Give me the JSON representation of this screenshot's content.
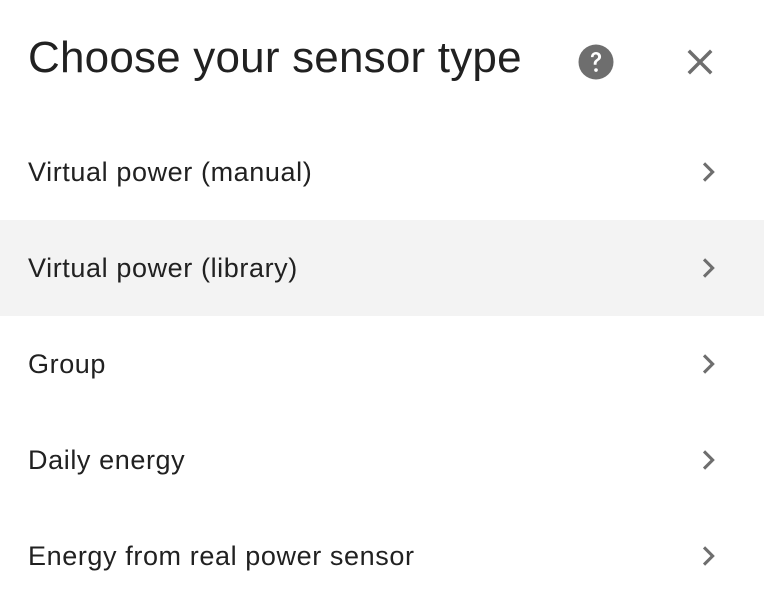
{
  "dialog": {
    "title": "Choose your sensor type",
    "help_icon": "help-circle-icon",
    "close_icon": "close-icon",
    "icon_color": "#6e6e6e",
    "hover_background": "#f3f3f3"
  },
  "list": {
    "items": [
      {
        "label": "Virtual power (manual)",
        "icon": "chevron-right-icon"
      },
      {
        "label": "Virtual power (library)",
        "icon": "chevron-right-icon",
        "state": "hovered"
      },
      {
        "label": "Group",
        "icon": "chevron-right-icon"
      },
      {
        "label": "Daily energy",
        "icon": "chevron-right-icon"
      },
      {
        "label": "Energy from real power sensor",
        "icon": "chevron-right-icon"
      }
    ]
  }
}
